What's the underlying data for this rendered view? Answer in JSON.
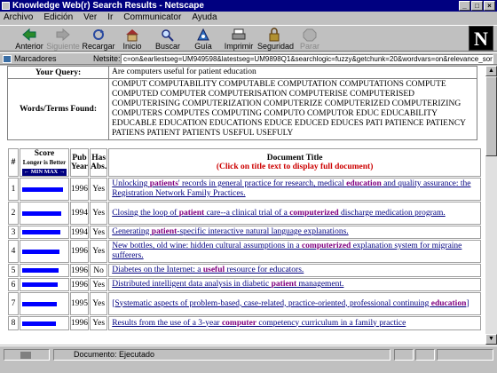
{
  "window": {
    "title": "Knowledge Web(r) Search Results - Netscape"
  },
  "menu": [
    "Archivo",
    "Edición",
    "Ver",
    "Ir",
    "Communicator",
    "Ayuda"
  ],
  "toolbar": {
    "buttons": [
      {
        "label": "Anterior",
        "icon": "back-arrow-icon",
        "enabled": true
      },
      {
        "label": "Siguiente",
        "icon": "forward-arrow-icon",
        "enabled": false
      },
      {
        "label": "Recargar",
        "icon": "reload-icon",
        "enabled": true
      },
      {
        "label": "Inicio",
        "icon": "home-icon",
        "enabled": true
      },
      {
        "label": "Buscar",
        "icon": "search-icon",
        "enabled": true
      },
      {
        "label": "Guía",
        "icon": "guide-icon",
        "enabled": true
      },
      {
        "label": "Imprimir",
        "icon": "print-icon",
        "enabled": true
      },
      {
        "label": "Seguridad",
        "icon": "security-lock-icon",
        "enabled": true
      },
      {
        "label": "Parar",
        "icon": "stop-icon",
        "enabled": false
      }
    ]
  },
  "location": {
    "bookmarks_label": "Marcadores",
    "netsite_label": "Netsite:",
    "url": "c=on&earliestseg=UM949598&latestseg=UM9898Q1&searchlogic=fuzzy&getchunk=20&wordvars=on&relevance_sort=on"
  },
  "query": {
    "your_query_label": "Your Query:",
    "your_query_value": "Are computers useful for patient education",
    "terms_label": "Words/Terms Found:",
    "terms_value": "COMPUT COMPUTABILITY COMPUTABLE COMPUTATION COMPUTATIONS COMPUTE COMPUTED COMPUTER COMPUTERISATION COMPUTERISE COMPUTERISED COMPUTERISING COMPUTERIZATION COMPUTERIZE COMPUTERIZED COMPUTERIZING COMPUTERS COMPUTES COMPUTING COMPUTO COMPUTOR EDUC EDUCABILITY EDUCABLE EDUCATION EDUCATIONS EDUCE EDUCED EDUCES PATI PATIENCE PATIENCY PATIENS PATIENT PATIENTS USEFUL USEFULY"
  },
  "results_header": {
    "num": "#",
    "score": "Score",
    "score_sub": "Longer is Better",
    "score_scale": "← MIN MAX →",
    "pub": "Pub",
    "year": "Year",
    "has": "Has",
    "abs": "Abs.",
    "title": "Document Title",
    "title_hint": "(Click on title text to display full document)"
  },
  "results": [
    {
      "n": "1",
      "score": 0.92,
      "year": "1996",
      "abs": "Yes",
      "title": [
        {
          "t": "Unlocking "
        },
        {
          "b": "patients"
        },
        {
          "t": "' records in general practice for research, medical "
        },
        {
          "b": "education"
        },
        {
          "t": " and quality assurance: the Registration Network Family Practices."
        }
      ]
    },
    {
      "n": "2",
      "score": 0.88,
      "year": "1994",
      "abs": "Yes",
      "title": [
        {
          "t": "Closing the loop of "
        },
        {
          "b": "patient"
        },
        {
          "t": " care--a clinical trial of a "
        },
        {
          "b": "computerized"
        },
        {
          "t": " discharge medication program."
        }
      ]
    },
    {
      "n": "3",
      "score": 0.86,
      "year": "1994",
      "abs": "Yes",
      "title": [
        {
          "t": "Generating "
        },
        {
          "b": "patient"
        },
        {
          "t": "-specific interactive natural language explanations."
        }
      ]
    },
    {
      "n": "4",
      "score": 0.84,
      "year": "1996",
      "abs": "Yes",
      "title": [
        {
          "t": "New bottles, old wine: hidden cultural assumptions in a "
        },
        {
          "b": "computerized"
        },
        {
          "t": " explanation system for migraine sufferers."
        }
      ]
    },
    {
      "n": "5",
      "score": 0.82,
      "year": "1996",
      "abs": "No",
      "title": [
        {
          "t": "Diabetes on the Internet: a "
        },
        {
          "b": "useful"
        },
        {
          "t": " resource for educators."
        }
      ]
    },
    {
      "n": "6",
      "score": 0.8,
      "year": "1996",
      "abs": "Yes",
      "title": [
        {
          "t": "Distributed intelligent data analysis in diabetic "
        },
        {
          "b": "patient"
        },
        {
          "t": " management."
        }
      ]
    },
    {
      "n": "7",
      "score": 0.78,
      "year": "1995",
      "abs": "Yes",
      "title": [
        {
          "t": "[Systematic aspects of problem-based, case-related, practice-oriented, professional continuing "
        },
        {
          "b": "education"
        },
        {
          "t": "]"
        }
      ]
    },
    {
      "n": "8",
      "score": 0.76,
      "year": "1996",
      "abs": "Yes",
      "title": [
        {
          "t": "Results from the use of a 3-year "
        },
        {
          "b": "computer"
        },
        {
          "t": " competency curriculum in a family practice"
        }
      ]
    }
  ],
  "status": {
    "text": "Documento: Ejecutado"
  }
}
